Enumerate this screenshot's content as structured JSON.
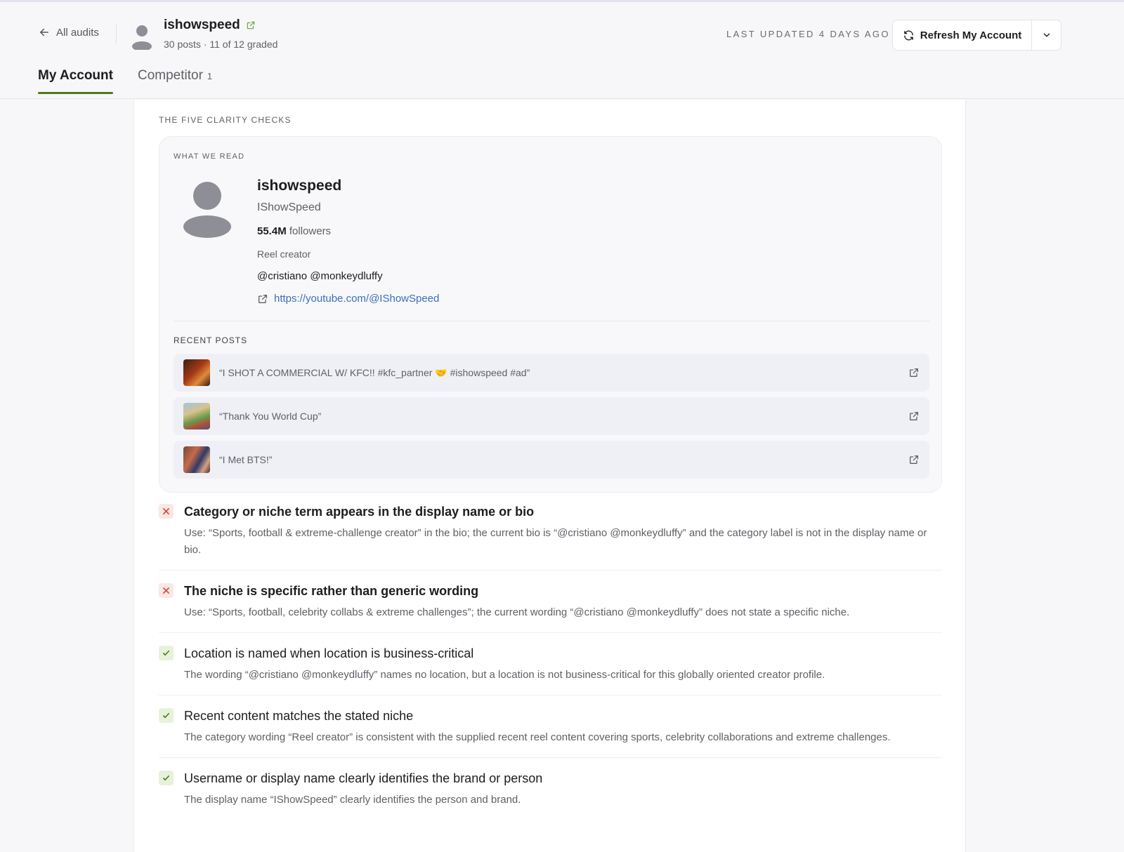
{
  "header": {
    "back_label": "All audits",
    "account_name": "ishowspeed",
    "account_meta": "30 posts · 11 of 12 graded",
    "last_updated": "LAST UPDATED 4 DAYS AGO",
    "refresh_label": "Refresh My Account"
  },
  "tabs": [
    {
      "label": "My Account",
      "active": true
    },
    {
      "label": "Competitor",
      "count": "1"
    }
  ],
  "section_label": "THE FIVE CLARITY CHECKS",
  "read": {
    "label": "WHAT WE READ",
    "username": "ishowspeed",
    "display_name": "IShowSpeed",
    "followers_value": "55.4M",
    "followers_label": "followers",
    "category": "Reel creator",
    "bio": "@cristiano @monkeydluffy",
    "link": "https://youtube.com/@IShowSpeed",
    "recent_label": "RECENT POSTS",
    "posts": [
      {
        "title": "“I SHOT A COMMERCIAL W/ KFC!! #kfc_partner 🤝 #ishowspeed #ad”"
      },
      {
        "title": "“Thank You World Cup”"
      },
      {
        "title": "“I Met BTS!”"
      }
    ]
  },
  "checks": [
    {
      "status": "fail",
      "title": "Category or niche term appears in the display name or bio",
      "body": "Use: “Sports, football & extreme-challenge creator” in the bio; the current bio is “@cristiano @monkeydluffy” and the category label is not in the display name or bio."
    },
    {
      "status": "fail",
      "title": "The niche is specific rather than generic wording",
      "body": "Use: “Sports, football, celebrity collabs & extreme challenges”; the current wording “@cristiano @monkeydluffy” does not state a specific niche."
    },
    {
      "status": "pass",
      "title": "Location is named when location is business-critical",
      "body": "The wording “@cristiano @monkeydluffy” names no location, but a location is not business-critical for this globally oriented creator profile."
    },
    {
      "status": "pass",
      "title": "Recent content matches the stated niche",
      "body": "The category wording “Reel creator” is consistent with the supplied recent reel content covering sports, celebrity collaborations and extreme challenges."
    },
    {
      "status": "pass",
      "title": "Username or display name clearly identifies the brand or person",
      "body": "The display name “IShowSpeed” clearly identifies the person and brand."
    }
  ],
  "colors": {
    "accent": "#4d7a1f",
    "link": "#3a6fb8",
    "fail": "#d9473a",
    "pass": "#4d7a1f"
  }
}
